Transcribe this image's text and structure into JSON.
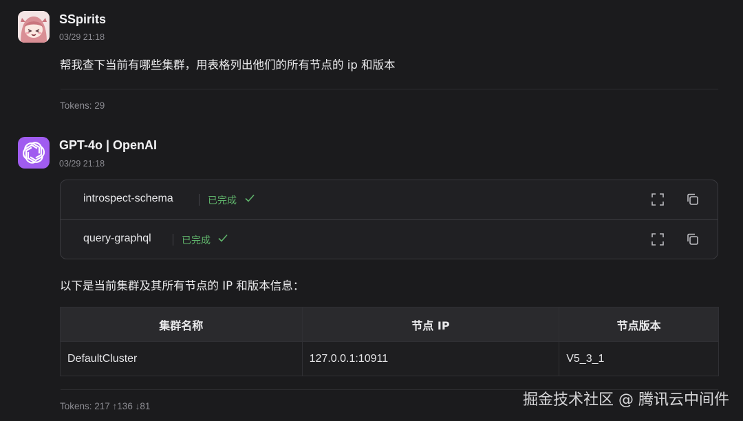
{
  "messages": {
    "user": {
      "name": "SSpirits",
      "time": "03/29 21:18",
      "text": "帮我查下当前有哪些集群，用表格列出他们的所有节点的 ip 和版本",
      "tokens": "Tokens: 29",
      "avatar_icon": "anime-avatar-icon"
    },
    "assistant": {
      "name": "GPT-4o | OpenAI",
      "time": "03/29 21:18",
      "avatar_icon": "openai-logo-icon",
      "tools": [
        {
          "name": "introspect-schema",
          "status": "已完成"
        },
        {
          "name": "query-graphql",
          "status": "已完成"
        }
      ],
      "text": "以下是当前集群及其所有节点的 IP 和版本信息：",
      "table": {
        "headers": [
          "集群名称",
          "节点 IP",
          "节点版本"
        ],
        "rows": [
          [
            "DefaultCluster",
            "127.0.0.1:10911",
            "V5_3_1"
          ]
        ]
      },
      "tokens": "Tokens: 217 ↑136 ↓81"
    }
  },
  "watermark": "掘金技术社区 @ 腾讯云中间件",
  "colors": {
    "background": "#1b1b1d",
    "status_green": "#5fb36b",
    "openai_purple": "#a05cf0"
  }
}
